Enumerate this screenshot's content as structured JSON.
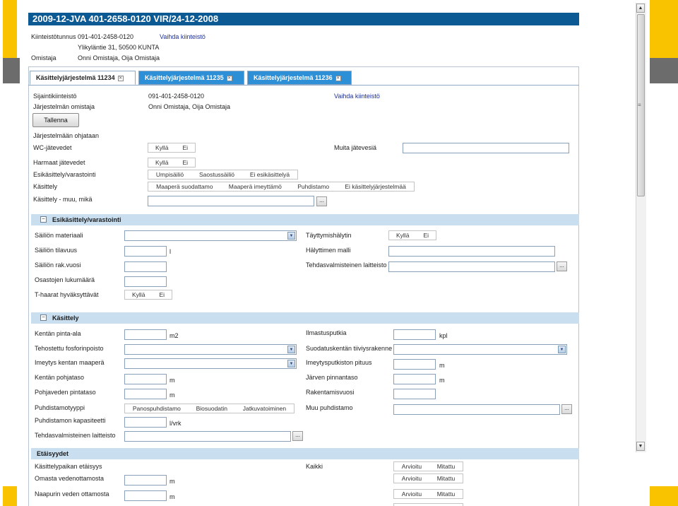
{
  "colors": {
    "accent_yellow": "#f9c300",
    "deco_gray": "#6c6c6c",
    "title_bar": "#0c5a93",
    "section_bg": "#c9dff0",
    "active_tab": "#ffffff",
    "inactive_tab": "#2d8fd6",
    "link": "#1c2f9a"
  },
  "header": {
    "title": "2009-12-JVA 401-2658-0120 VIR/24-12-2008",
    "property_id_label": "Kiinteistötunnus",
    "property_id_value": "091-401-2458-0120",
    "change_property_link": "Vaihda kiinteistö",
    "address_value": "Ylikyläntie 31, 50500 KUNTA",
    "owner_label": "Omistaja",
    "owner_value": "Onni Omistaja, Oija Omistaja"
  },
  "tabs": [
    {
      "label": "Käsittelyjärjestelmä 11234",
      "close_icon": "close-icon"
    },
    {
      "label": "Käsittelyjärjestelmä 11235",
      "close_icon": "close-icon"
    },
    {
      "label": "Käsittelyjärjestelmä 11236",
      "close_icon": "close-icon"
    }
  ],
  "form": {
    "location_label": "Sijaintikiinteistö",
    "location_value": "091-401-2458-0120",
    "change_link": "Vaihda kiinteistö",
    "system_owner_label": "Järjestelmän omistaja",
    "system_owner_value": "Onni Omistaja, Oija Omistaja",
    "save_button": "Tallenna",
    "directed_label": "Järjestelmään ohjataan",
    "wc_label": "WC-jätevedet",
    "other_waste_label": "Muita jätevesiä",
    "grey_water_label": "Harmaat jätevedet",
    "pretreatment_label": "Esikäsittely/varastointi",
    "treatment_label": "Käsittely",
    "treatment_other_label": "Käsittely - muu, mikä",
    "yes": "Kyllä",
    "no": "Ei",
    "pretreatment_options": [
      "Umpisäiliö",
      "Saostussäiliö",
      "Ei esikäsittelyä"
    ],
    "treatment_options": [
      "Maaperä suodattamo",
      "Maaperä imeyttämö",
      "Puhdistamo",
      "Ei käsittelyjärjestelmää"
    ],
    "dots": "..."
  },
  "section_pre": {
    "title": "Esikäsittely/varastointi",
    "toggle": "−",
    "tank_material_label": "Säiliön materiaali",
    "fill_alarm_label": "Täyttymishälytin",
    "tank_volume_label": "Säiliön tilavuus",
    "tank_volume_unit": "l",
    "alarm_model_label": "Hälyttimen malli",
    "tank_year_label": "Säiliön rak.vuosi",
    "factory_device_label": "Tehdasvalmisteinen laitteisto",
    "compartments_label": "Osastojen lukumäärä",
    "t_branch_label": "T-haarat hyväksyttävät"
  },
  "section_treat": {
    "title": "Käsittely",
    "toggle": "−",
    "field_area_label": "Kentän pinta-ala",
    "field_area_unit": "m2",
    "vent_pipe_label": "Ilmastusputkia",
    "vent_pipe_unit": "kpl",
    "phosphorus_label": "Tehostettu fosforinpoisto",
    "filter_structure_label": "Suodatuskentän tiiviysrakenne",
    "soil_label": "Imeytys kentan maaperä",
    "pipe_length_label": "Imeytysputkiston pituus",
    "pipe_length_unit": "m",
    "bottom_level_label": "Kentän pohjataso",
    "bottom_level_unit": "m",
    "lake_level_label": "Järven pinnantaso",
    "lake_level_unit": "m",
    "groundwater_label": "Pohjaveden pintataso",
    "groundwater_unit": "m",
    "build_year_label": "Rakentamisvuosi",
    "plant_type_label": "Puhdistamotyyppi",
    "plant_type_options": [
      "Panospuhdistamo",
      "Biosuodatin",
      "Jatkuvatoiminen"
    ],
    "other_plant_label": "Muu puhdistamo",
    "plant_capacity_label": "Puhdistamon kapasiteetti",
    "plant_capacity_unit": "l/vrk",
    "factory_device_label": "Tehdasvalmisteinen laitteisto"
  },
  "section_dist": {
    "title": "Etäisyydet",
    "distance_label": "Käsittelypaikan etäisyys",
    "all_label": "Kaikki",
    "own_water_label": "Omasta vedenottamosta",
    "own_water_unit": "m",
    "neighbour_water_label": "Naapurin veden ottamosta",
    "neighbour_water_unit": "m",
    "estimated": "Arvioitu",
    "measured": "Mitattu"
  },
  "scrollbar": {
    "up": "▲",
    "down": "▼",
    "grip": "≡"
  }
}
